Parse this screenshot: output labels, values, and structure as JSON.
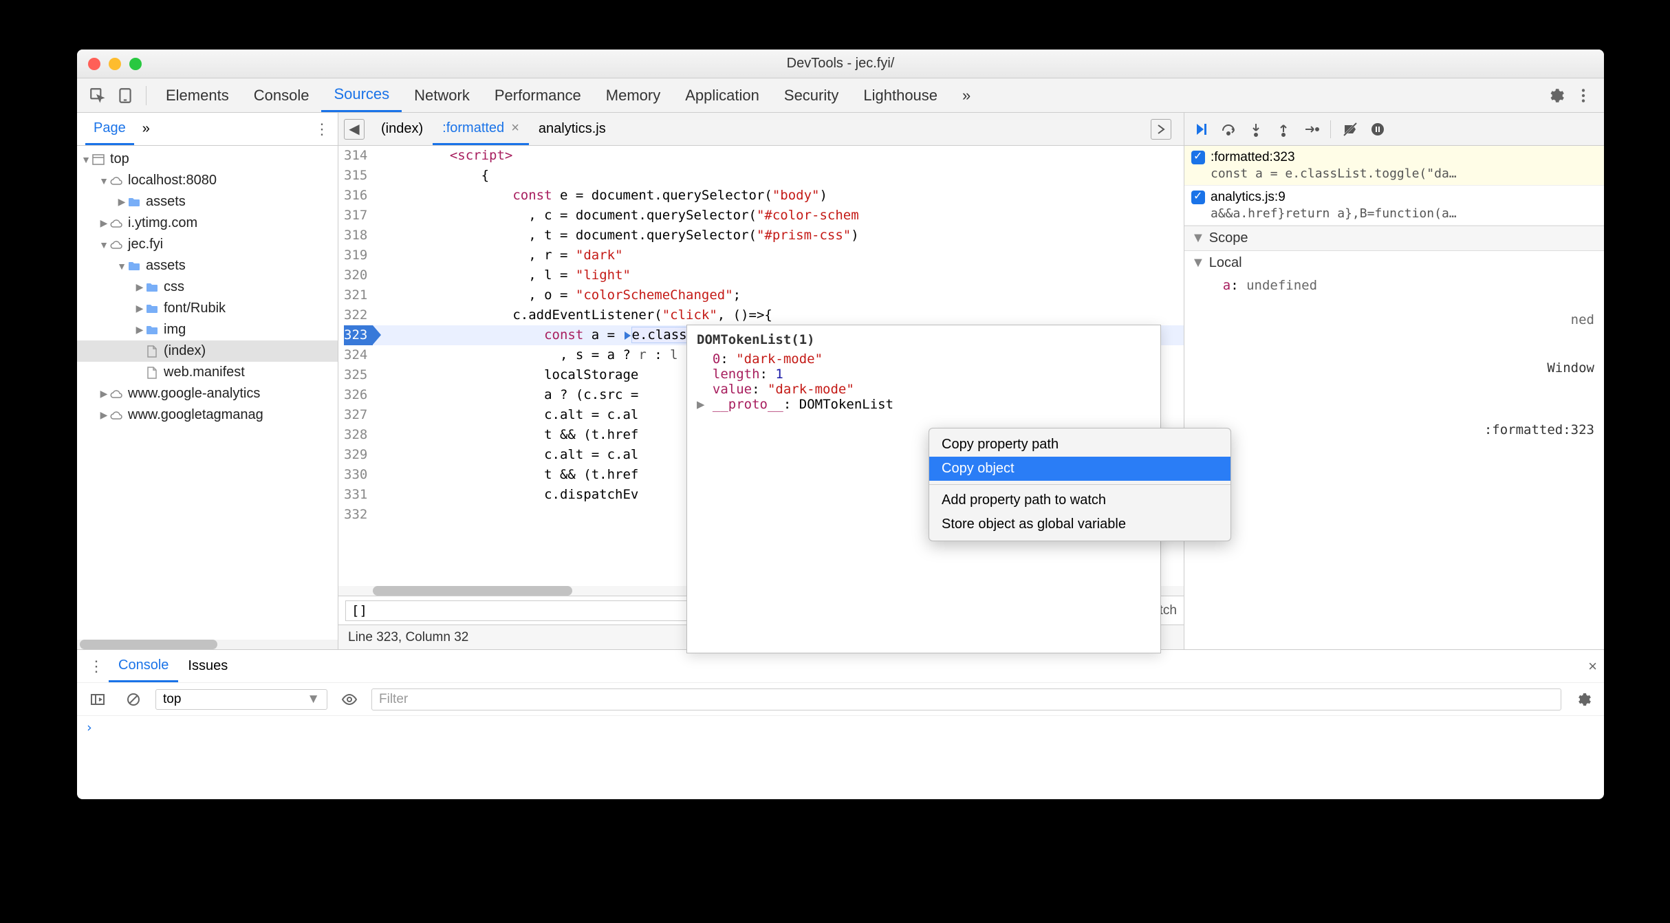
{
  "window": {
    "title": "DevTools - jec.fyi/"
  },
  "tabs": [
    "Elements",
    "Console",
    "Sources",
    "Network",
    "Performance",
    "Memory",
    "Application",
    "Security",
    "Lighthouse"
  ],
  "active_tab": "Sources",
  "sidebar": {
    "tabs": {
      "page": "Page",
      "chev": "»"
    },
    "tree": [
      {
        "indent": 0,
        "arrow": "▼",
        "kind": "frame",
        "label": "top"
      },
      {
        "indent": 1,
        "arrow": "▼",
        "kind": "cloud",
        "label": "localhost:8080"
      },
      {
        "indent": 2,
        "arrow": "▶",
        "kind": "folder",
        "label": "assets"
      },
      {
        "indent": 1,
        "arrow": "▶",
        "kind": "cloud",
        "label": "i.ytimg.com"
      },
      {
        "indent": 1,
        "arrow": "▼",
        "kind": "cloud",
        "label": "jec.fyi"
      },
      {
        "indent": 2,
        "arrow": "▼",
        "kind": "folder",
        "label": "assets"
      },
      {
        "indent": 3,
        "arrow": "▶",
        "kind": "folder",
        "label": "css"
      },
      {
        "indent": 3,
        "arrow": "▶",
        "kind": "folder",
        "label": "font/Rubik"
      },
      {
        "indent": 3,
        "arrow": "▶",
        "kind": "folder",
        "label": "img"
      },
      {
        "indent": 3,
        "arrow": "",
        "kind": "file",
        "label": "(index)",
        "selected": true
      },
      {
        "indent": 3,
        "arrow": "",
        "kind": "file",
        "label": "web.manifest"
      },
      {
        "indent": 1,
        "arrow": "▶",
        "kind": "cloud",
        "label": "www.google-analytics"
      },
      {
        "indent": 1,
        "arrow": "▶",
        "kind": "cloud",
        "label": "www.googletagmanag"
      }
    ]
  },
  "editor": {
    "nav_prev": "◀",
    "tabs": [
      {
        "label": "(index)",
        "active": false,
        "close": false
      },
      {
        "label": ":formatted",
        "active": true,
        "close": true
      },
      {
        "label": "analytics.js",
        "active": false,
        "close": false
      }
    ],
    "next": "▶",
    "lines": {
      "314": {
        "html": "        <span class='tag'>&lt;script&gt;</span>"
      },
      "315": {
        "html": "            {"
      },
      "316": {
        "html": "                <span class='kw'>const</span> e = document.querySelector(<span class='str'>\"body\"</span>)"
      },
      "317": {
        "html": "                  , c = document.querySelector(<span class='str'>\"#color-schem</span>"
      },
      "318": {
        "html": "                  , t = document.querySelector(<span class='str'>\"#prism-css\"</span>)"
      },
      "319": {
        "html": "                  , r = <span class='str'>\"dark\"</span>"
      },
      "320": {
        "html": "                  , l = <span class='str'>\"light\"</span>"
      },
      "321": {
        "html": "                  , o = <span class='str'>\"colorSchemeChanged\"</span>;"
      },
      "322": {
        "html": "                c.addEventListener(<span class='str'>\"click\"</span>, ()=>{"
      },
      "323": {
        "html": "                    <span class='kw'>const</span> a = <span class='step-arrow'></span><span class='hl-token'>e.classList</span>.<span class='step-arrow'></span>toggle(<span class='str'>\"dark-mo</span>",
        "bp": true
      },
      "324": {
        "html": "                      , s = a ? <span class='op'>r</span> : <span class='op'>l</span>"
      },
      "325": {
        "html": "                    localStorage"
      },
      "326": {
        "html": "                    a ? (c.src ="
      },
      "327": {
        "html": "                    c.alt = c.al"
      },
      "328": {
        "html": "                    t && (t.href"
      },
      "329": {
        "html": "                    c.alt = c.al"
      },
      "330": {
        "html": "                    t && (t.href"
      },
      "331": {
        "html": "                    c.dispatchEv"
      },
      "332": {
        "html": ""
      }
    },
    "search": {
      "value": "[]",
      "matches": "1 match"
    },
    "status": "Line 323, Column 32"
  },
  "debugger": {
    "breakpoints": [
      {
        "label": ":formatted:323",
        "code": "const a = e.classList.toggle(\"da…",
        "highlight": true
      },
      {
        "label": "analytics.js:9",
        "code": "a&&a.href}return a},B=function(a…",
        "highlight": false
      }
    ],
    "scope_label": "Scope",
    "local_label": "Local",
    "vars": [
      {
        "name": "a",
        "value": "undefined"
      }
    ],
    "truncated": "ned",
    "global": {
      "label": "Window"
    },
    "callstack_ref": ":formatted:323"
  },
  "tooltip": {
    "header": "DOMTokenList(1)",
    "rows": [
      {
        "key": "0",
        "val": "\"dark-mode\"",
        "type": "str"
      },
      {
        "key": "length",
        "val": "1",
        "type": "num"
      },
      {
        "key": "value",
        "val": "\"dark-mode\"",
        "type": "str"
      }
    ],
    "proto": {
      "key": "__proto__",
      "val": "DOMTokenList"
    }
  },
  "context_menu": {
    "items": [
      {
        "label": "Copy property path",
        "selected": false
      },
      {
        "label": "Copy object",
        "selected": true
      },
      {
        "sep": true
      },
      {
        "label": "Add property path to watch",
        "selected": false
      },
      {
        "label": "Store object as global variable",
        "selected": false
      }
    ]
  },
  "drawer": {
    "tabs": [
      "Console",
      "Issues"
    ],
    "active": "Console",
    "context": "top",
    "filter_placeholder": "Filter",
    "prompt": "›"
  }
}
